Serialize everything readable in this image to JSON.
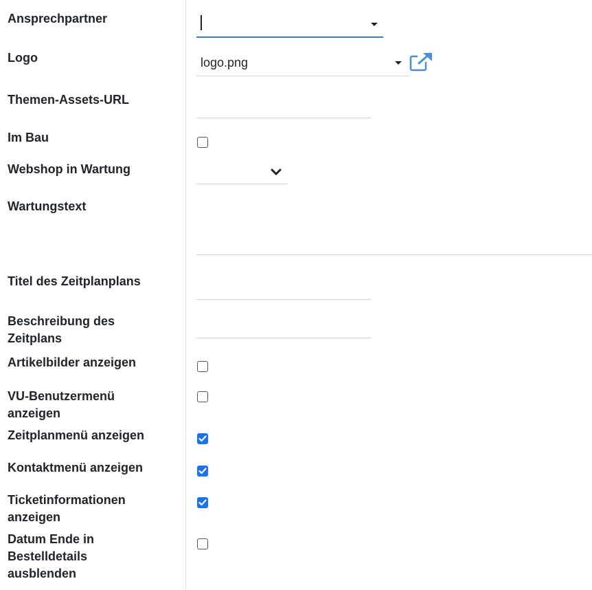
{
  "form": {
    "fields": [
      {
        "key": "ansprechpartner",
        "label": "Ansprechpartner",
        "type": "many2one",
        "value": ""
      },
      {
        "key": "logo",
        "label": "Logo",
        "type": "many2one",
        "value": "logo.png"
      },
      {
        "key": "themen_assets_url",
        "label": "Themen-Assets-URL",
        "type": "char",
        "value": ""
      },
      {
        "key": "im_bau",
        "label": "Im Bau",
        "type": "boolean",
        "checked": false
      },
      {
        "key": "webshop_in_wartung",
        "label": "Webshop in Wartung",
        "type": "selection",
        "value": ""
      },
      {
        "key": "wartungstext",
        "label": "Wartungstext",
        "type": "text",
        "value": ""
      },
      {
        "key": "titel_zeitplanplans",
        "label": "Titel des Zeitplanplans",
        "type": "char",
        "value": ""
      },
      {
        "key": "beschreibung_zeitplans",
        "label": "Beschreibung des Zeitplans",
        "type": "char",
        "value": ""
      },
      {
        "key": "artikelbilder_anzeigen",
        "label": "Artikelbilder anzeigen",
        "type": "boolean",
        "checked": false
      },
      {
        "key": "vu_benutzermenue_anzeigen",
        "label": "VU-Benutzermenü anzeigen",
        "type": "boolean",
        "checked": false
      },
      {
        "key": "zeitplanmenue_anzeigen",
        "label": "Zeitplanmenü anzeigen",
        "type": "boolean",
        "checked": true
      },
      {
        "key": "kontaktmenue_anzeigen",
        "label": "Kontaktmenü anzeigen",
        "type": "boolean",
        "checked": true
      },
      {
        "key": "ticketinformationen_anzeigen",
        "label": "Ticketinformationen anzeigen",
        "type": "boolean",
        "checked": true
      },
      {
        "key": "datum_ende_ausblenden",
        "label": "Datum Ende in Bestelldetails ausblenden",
        "type": "boolean",
        "checked": false
      }
    ]
  },
  "icons": {
    "dropdown": "caret-down-icon",
    "external": "external-link-icon",
    "select": "chevron-down-icon",
    "check": "check-icon"
  },
  "colors": {
    "focus_underline": "#3b7cbf",
    "checkbox_checked": "#1a73e8",
    "external_link": "#4a8fd6"
  }
}
